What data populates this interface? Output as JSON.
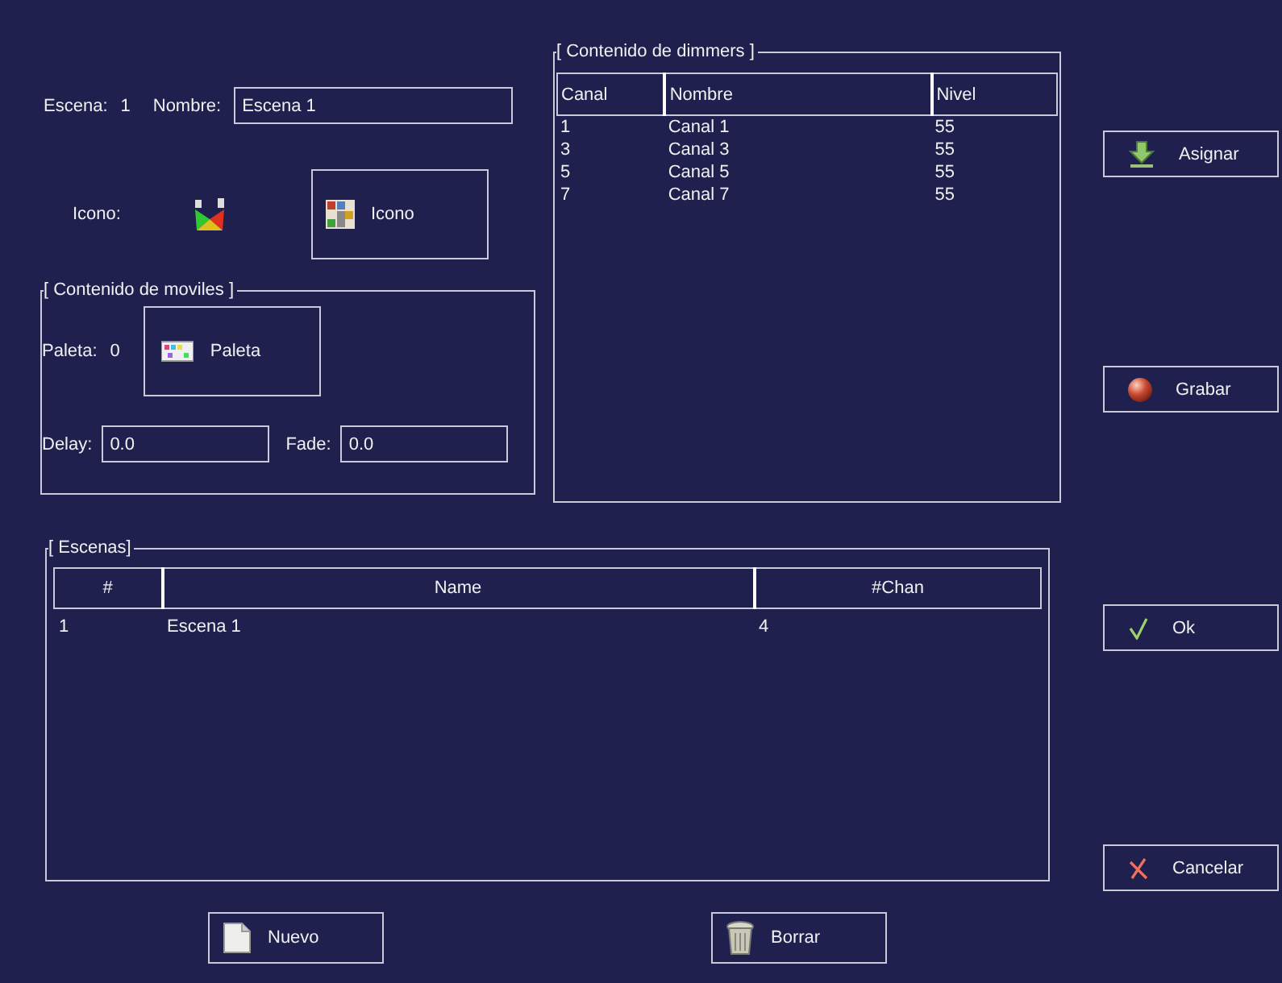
{
  "scene": {
    "label": "Escena:",
    "number": "1",
    "name_label": "Nombre:",
    "name_value": "Escena 1"
  },
  "icon_row": {
    "label": "Icono:",
    "button": "Icono"
  },
  "moviles": {
    "title": "[ Contenido de moviles ]",
    "palette_label": "Paleta:",
    "palette_value": "0",
    "palette_button": "Paleta",
    "delay_label": "Delay:",
    "delay_value": "0.0",
    "fade_label": "Fade:",
    "fade_value": "0.0"
  },
  "dimmers": {
    "title": "[ Contenido de dimmers ]",
    "columns": [
      "Canal",
      "Nombre",
      "Nivel"
    ],
    "rows": [
      [
        "1",
        "Canal 1",
        "55"
      ],
      [
        "3",
        "Canal 3",
        "55"
      ],
      [
        "5",
        "Canal 5",
        "55"
      ],
      [
        "7",
        "Canal 7",
        "55"
      ]
    ]
  },
  "side_buttons": [
    {
      "label": "Asignar",
      "kind": "assign"
    },
    {
      "label": "Grabar",
      "kind": "record"
    },
    {
      "label": "Ok",
      "kind": "ok"
    },
    {
      "label": "Cancelar",
      "kind": "cancel"
    }
  ],
  "escenas": {
    "title": "[ Escenas]",
    "columns": [
      "#",
      "Name",
      "#Chan"
    ],
    "rows": [
      [
        "1",
        "Escena 1",
        "4"
      ]
    ]
  },
  "bottom_buttons": [
    {
      "label": "Nuevo",
      "kind": "new"
    },
    {
      "label": "Borrar",
      "kind": "delete"
    }
  ]
}
